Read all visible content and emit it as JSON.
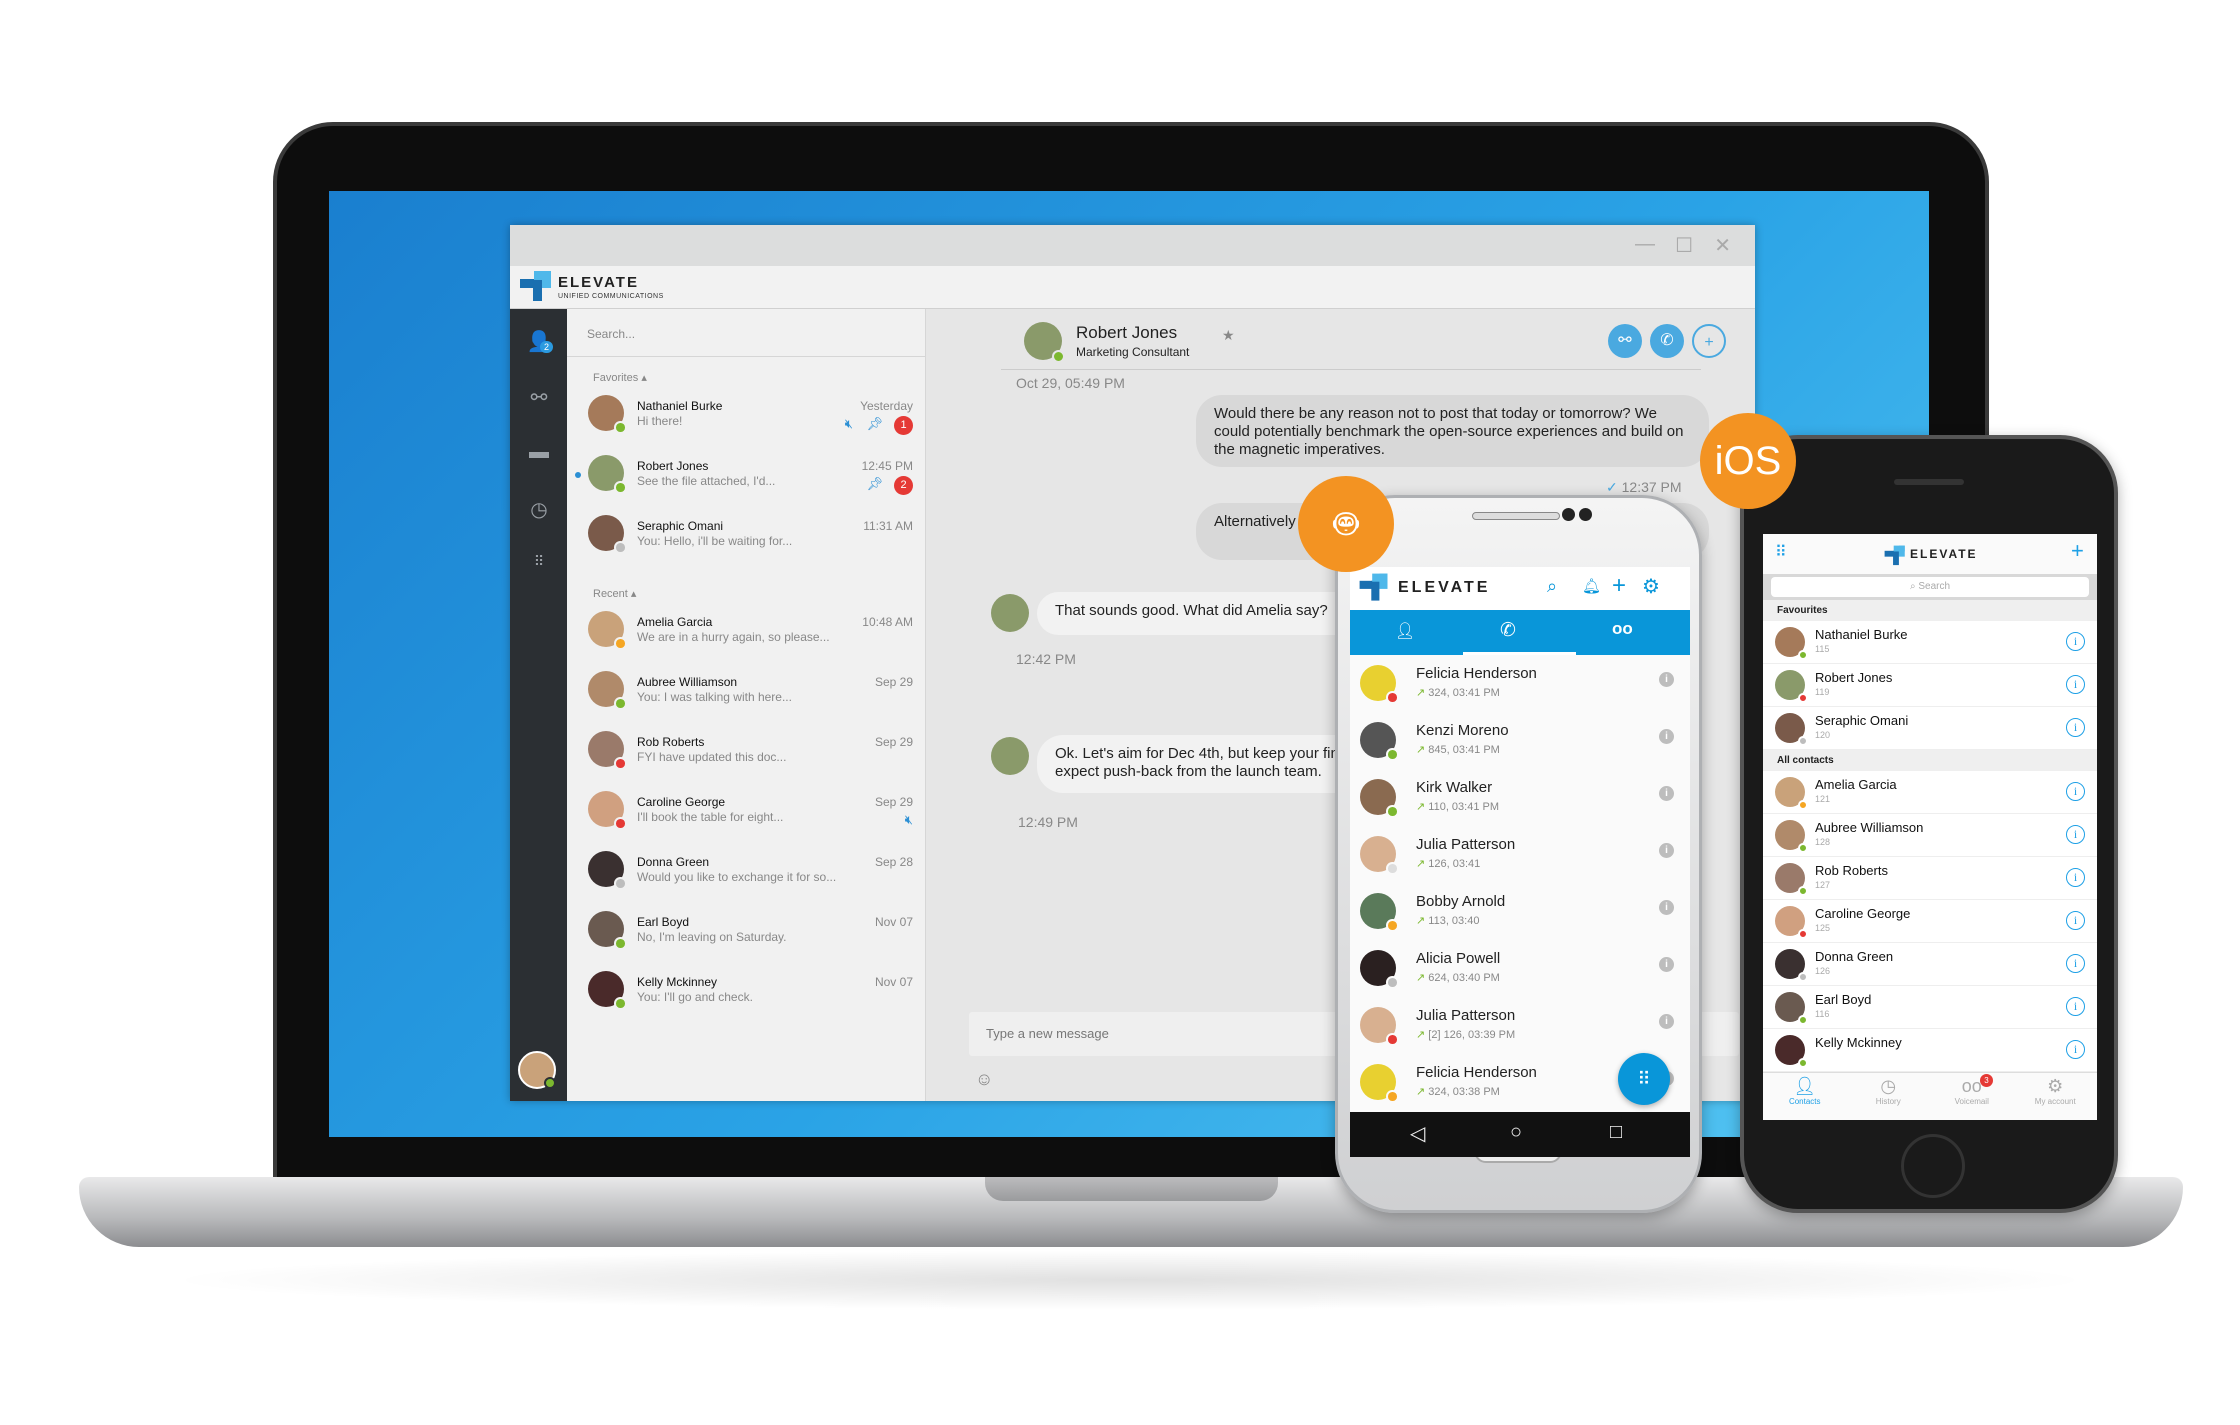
{
  "colors": {
    "brand_blue": "#0996d9",
    "accent_orange": "#f39322",
    "sidebar_dark": "#2b2f33",
    "status_online": "#7cb82f",
    "status_busy": "#e53935",
    "status_away": "#f5a623",
    "status_offline": "#bdbdbd"
  },
  "desktop": {
    "brand": {
      "name": "ELEVATE",
      "tagline": "UNIFIED COMMUNICATIONS"
    },
    "window_controls": {
      "minimize": "—",
      "maximize": "☐",
      "close": "✕"
    },
    "sidebar": {
      "contacts_badge": "2",
      "items": [
        "contacts-icon",
        "share-icon",
        "folder-icon",
        "clock-icon",
        "dialpad-icon"
      ]
    },
    "search_placeholder": "Search...",
    "favorites_label": "Favorites",
    "recent_label": "Recent",
    "favorites": [
      {
        "name": "Nathaniel Burke",
        "msg": "Hi there!",
        "time": "Yesterday",
        "status": "online",
        "muted": true,
        "pinned": true,
        "unread": "1",
        "color": "#a57a5a"
      },
      {
        "name": "Robert Jones",
        "msg": "See the file attached, I'd...",
        "time": "12:45 PM",
        "status": "online",
        "pinned": true,
        "unread": "2",
        "active": true,
        "color": "#8a9a6a"
      },
      {
        "name": "Seraphic Omani",
        "msg": "You: Hello, i'll be waiting for...",
        "time": "11:31 AM",
        "status": "offline",
        "color": "#7a5a4a"
      }
    ],
    "recent": [
      {
        "name": "Amelia Garcia",
        "msg": "We are in a hurry again, so please...",
        "time": "10:48 AM",
        "status": "away",
        "color": "#c9a27a"
      },
      {
        "name": "Aubree Williamson",
        "msg": "You: I was talking with here...",
        "time": "Sep 29",
        "status": "online",
        "color": "#b08a6a"
      },
      {
        "name": "Rob Roberts",
        "msg": "FYI have updated this doc...",
        "time": "Sep 29",
        "status": "busy",
        "color": "#9a7a6a"
      },
      {
        "name": "Caroline George",
        "msg": "I'll book the table for eight...",
        "time": "Sep 29",
        "status": "busy",
        "muted": true,
        "color": "#d0a080"
      },
      {
        "name": "Donna Green",
        "msg": "Would you like to exchange it for so...",
        "time": "Sep 28",
        "status": "offline",
        "color": "#3a3030"
      },
      {
        "name": "Earl Boyd",
        "msg": "No, I'm leaving on Saturday.",
        "time": "Nov 07",
        "status": "online",
        "color": "#6a5a50"
      },
      {
        "name": "Kelly Mckinney",
        "msg": "You: I'll go and check.",
        "time": "Nov 07",
        "status": "online",
        "color": "#4a2a2a"
      }
    ],
    "chat": {
      "contact_name": "Robert Jones",
      "contact_title": "Marketing Consultant",
      "date": "Oct 29, 05:49 PM",
      "actions": [
        "share-icon",
        "phone-icon",
        "add-user-icon"
      ],
      "messages": [
        {
          "dir": "out",
          "text": "Would there be any reason not to post that today or tomorrow? We could potentially benchmark the open-source experiences  and build on the magnetic imperatives.",
          "time": "12:37 PM"
        },
        {
          "dir": "out",
          "text": "Alternatively discussion. T"
        },
        {
          "dir": "in",
          "text": "That sounds good. What did Amelia say?",
          "time": "12:42 PM"
        },
        {
          "dir": "in",
          "text": "Ok. Let's aim for Dec 4th, but keep your fing expect push-back from the launch team.",
          "time": "12:49 PM"
        }
      ],
      "input_placeholder": "Type a new message"
    }
  },
  "android": {
    "badge": "android-icon",
    "brand": "ELEVATE",
    "tabs": [
      "contacts-icon",
      "phone-icon",
      "voicemail-icon"
    ],
    "active_tab": 1,
    "calls": [
      {
        "name": "Felicia Henderson",
        "detail": "324, 03:41 PM",
        "status": "busy",
        "color": "#e8d030"
      },
      {
        "name": "Kenzi Moreno",
        "detail": "845, 03:41 PM",
        "status": "online",
        "color": "#555"
      },
      {
        "name": "Kirk Walker",
        "detail": "110, 03:41 PM",
        "status": "online",
        "color": "#8a6a50"
      },
      {
        "name": "Julia Patterson",
        "detail": "126, 03:41",
        "status": "unknown",
        "color": "#d8b090"
      },
      {
        "name": "Bobby Arnold",
        "detail": "113, 03:40",
        "status": "away",
        "color": "#5a7a5a"
      },
      {
        "name": "Alicia Powell",
        "detail": "624, 03:40 PM",
        "status": "offline",
        "color": "#2a2020"
      },
      {
        "name": "Julia Patterson",
        "detail": "[2] 126, 03:39 PM",
        "status": "busy",
        "color": "#d8b090"
      },
      {
        "name": "Felicia Henderson",
        "detail": "324, 03:38 PM",
        "status": "away",
        "color": "#e8d030"
      }
    ],
    "nav": [
      "◁",
      "○",
      "□"
    ]
  },
  "ios": {
    "badge": "iOS",
    "brand": "ELEVATE",
    "search_placeholder": "Search",
    "favourites_label": "Favourites",
    "all_contacts_label": "All contacts",
    "favourites": [
      {
        "name": "Nathaniel Burke",
        "ext": "115",
        "status": "online",
        "color": "#a57a5a"
      },
      {
        "name": "Robert Jones",
        "ext": "119",
        "status": "busy",
        "color": "#8a9a6a"
      },
      {
        "name": "Seraphic Omani",
        "ext": "120",
        "status": "offline",
        "color": "#7a5a4a"
      }
    ],
    "contacts": [
      {
        "name": "Amelia Garcia",
        "ext": "121",
        "status": "away",
        "color": "#c9a27a"
      },
      {
        "name": "Aubree Williamson",
        "ext": "128",
        "status": "online",
        "color": "#b08a6a"
      },
      {
        "name": "Rob Roberts",
        "ext": "127",
        "status": "online",
        "color": "#9a7a6a"
      },
      {
        "name": "Caroline George",
        "ext": "125",
        "status": "busy",
        "color": "#d0a080"
      },
      {
        "name": "Donna Green",
        "ext": "126",
        "status": "offline",
        "color": "#3a3030"
      },
      {
        "name": "Earl Boyd",
        "ext": "116",
        "status": "online",
        "color": "#6a5a50"
      },
      {
        "name": "Kelly Mckinney",
        "ext": "",
        "status": "online",
        "color": "#4a2a2a"
      }
    ],
    "tabbar": [
      {
        "label": "Contacts",
        "active": true
      },
      {
        "label": "History"
      },
      {
        "label": "Voicemail",
        "badge": "3"
      },
      {
        "label": "My account"
      }
    ]
  }
}
